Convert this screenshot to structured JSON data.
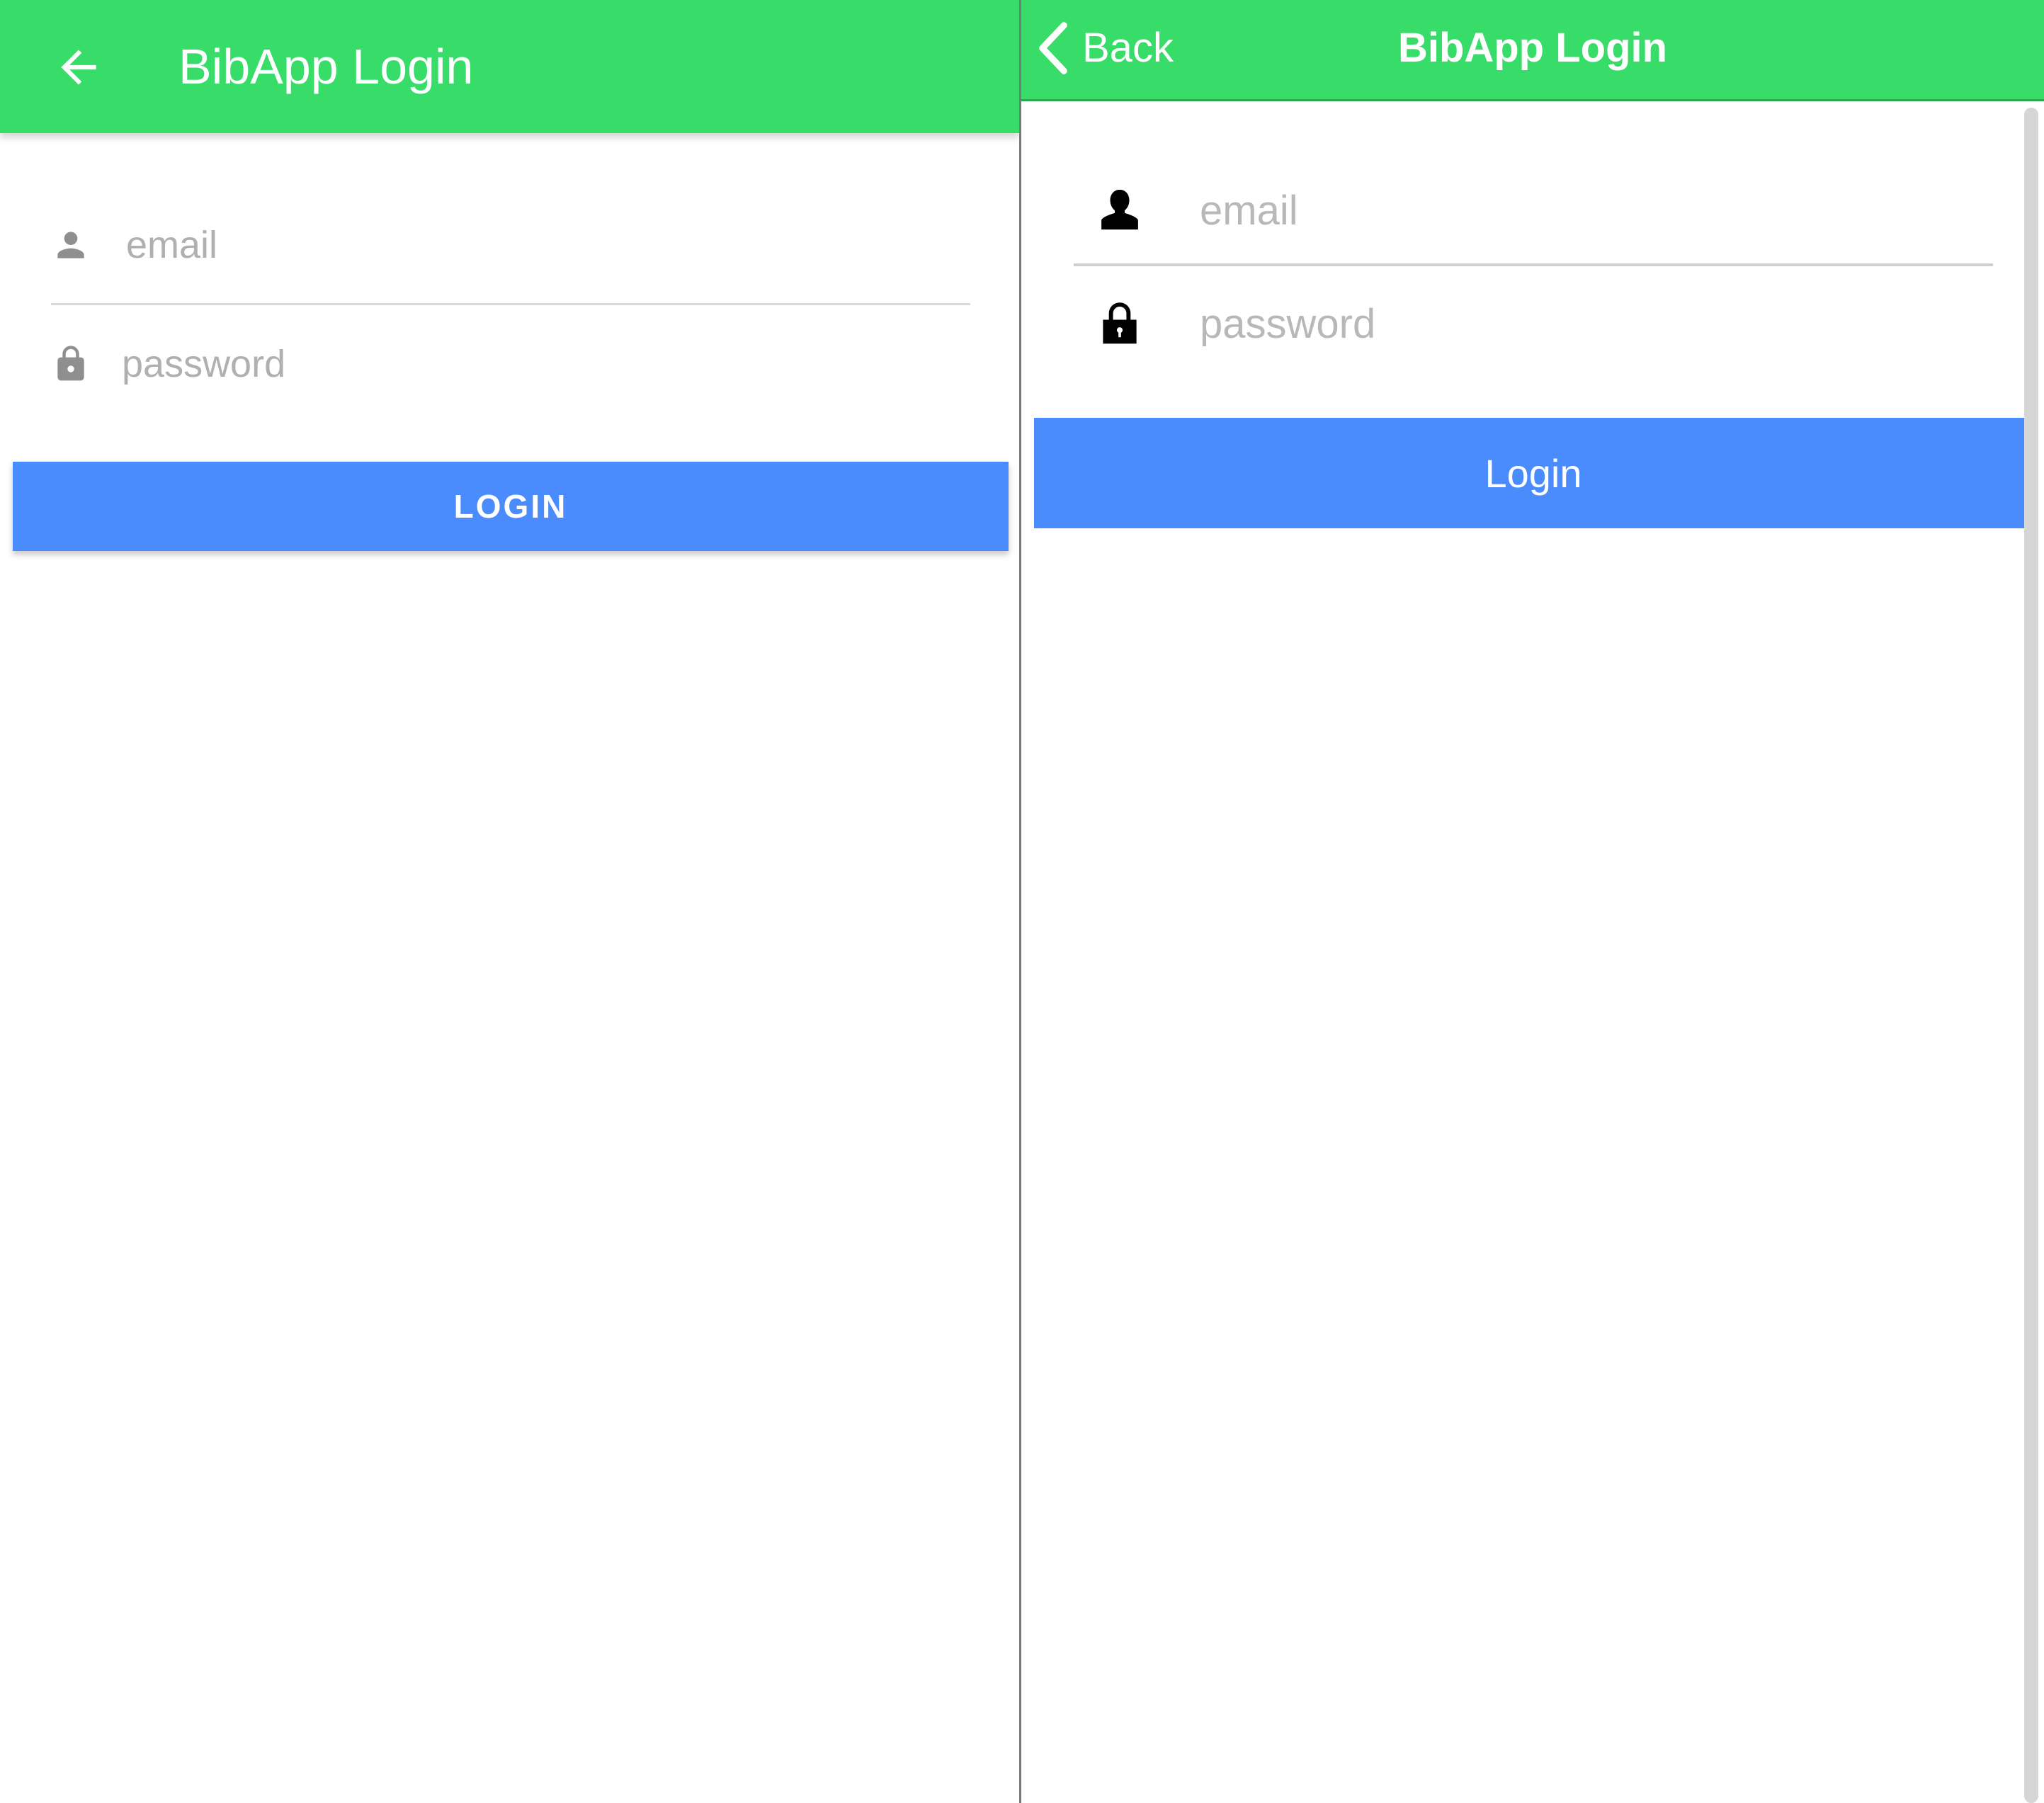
{
  "android": {
    "appbar": {
      "title": "BibApp Login",
      "back_icon": "arrow-left-icon",
      "color": "#37dd68"
    },
    "email": {
      "placeholder": "email",
      "value": "",
      "icon": "person-icon"
    },
    "password": {
      "placeholder": "password",
      "value": "",
      "icon": "lock-icon"
    },
    "login_button": {
      "label": "LOGIN",
      "color": "#4a8bfd"
    }
  },
  "ios": {
    "navbar": {
      "back_label": "Back",
      "back_icon": "chevron-left-icon",
      "title": "BibApp Login",
      "color": "#37dd68"
    },
    "email": {
      "placeholder": "email",
      "value": "",
      "icon": "user-silhouette-icon"
    },
    "password": {
      "placeholder": "password",
      "value": "",
      "icon": "padlock-icon"
    },
    "login_button": {
      "label": "Login",
      "color": "#4a8bfd"
    }
  }
}
